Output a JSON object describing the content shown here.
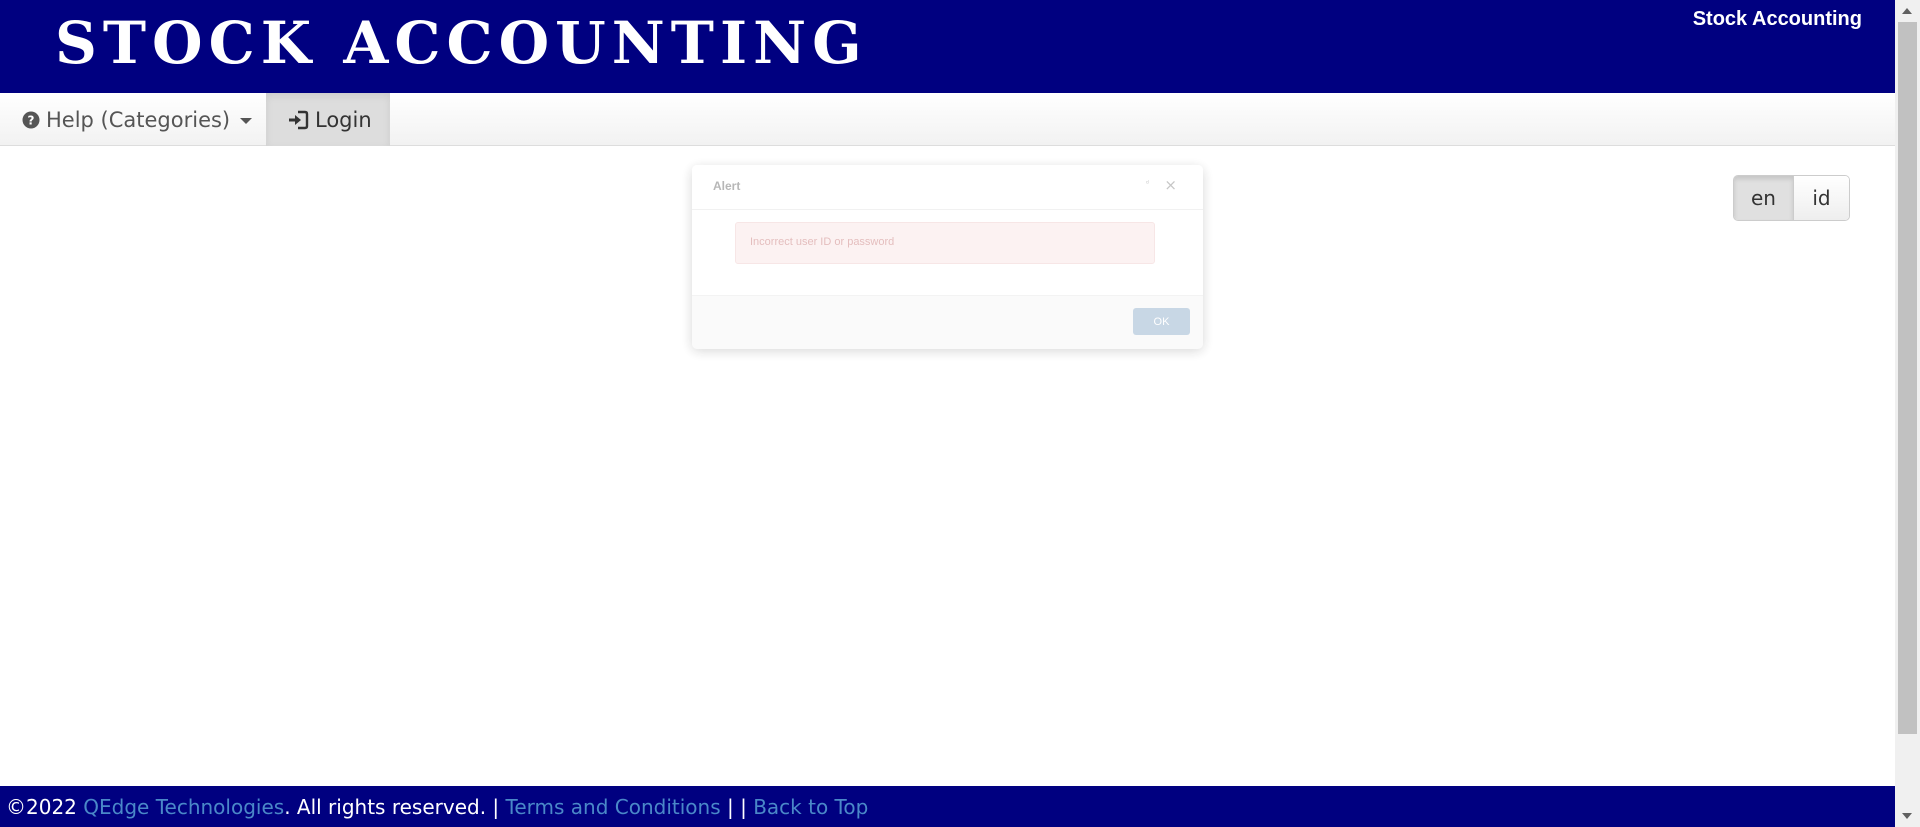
{
  "header": {
    "brand": "STOCK ACCOUNTING",
    "title": "Stock Accounting"
  },
  "navbar": {
    "help_label": "Help (Categories)",
    "help_icon": "question-circle-icon",
    "login_label": "Login",
    "login_icon": "sign-in-icon"
  },
  "language": {
    "options": [
      "en",
      "id"
    ],
    "selected": "en"
  },
  "modal": {
    "title": "Alert",
    "message": "Incorrect user ID or password",
    "ok_label": "OK",
    "close_glyph": "×",
    "minimize_glyph": "ᵈ"
  },
  "footer": {
    "copyright": "©2022 ",
    "company": "QEdge Technologies",
    "rights": ". All rights reserved. | ",
    "terms": "Terms and Conditions",
    "separator": " | | ",
    "back_to_top": "Back to Top"
  },
  "colors": {
    "brand_navy": "#000080",
    "link": "#4a88c8",
    "alert_bg": "#fcf1f1"
  }
}
